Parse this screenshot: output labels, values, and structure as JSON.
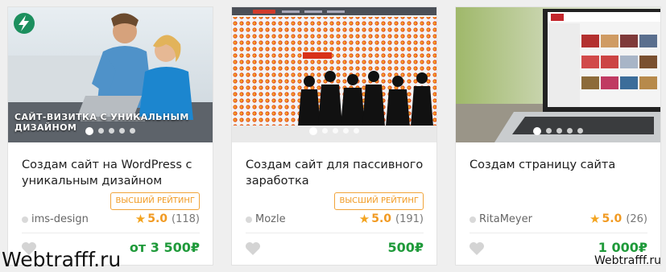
{
  "cards": [
    {
      "thumb_banner": "САЙТ-ВИЗИТКА С УНИКАЛЬНЫМ ДИЗАЙНОМ",
      "title": "Создам сайт на WordPress с уникальным дизайном",
      "badge": "ВЫСШИЙ РЕЙТИНГ",
      "seller": "ims-design",
      "rating": "5.0",
      "reviews": "(118)",
      "price": "от 3 500₽"
    },
    {
      "title": "Создам сайт для пассивного заработка",
      "badge": "ВЫСШИЙ РЕЙТИНГ",
      "seller": "Mozle",
      "rating": "5.0",
      "reviews": "(191)",
      "price": "500₽"
    },
    {
      "title": "Создам страницу сайта",
      "seller": "RitaMeyer",
      "rating": "5.0",
      "reviews": "(26)",
      "price": "1 000₽"
    }
  ],
  "icons": {
    "favorite": "heart-icon",
    "rating": "star-icon",
    "logo": "lightning-logo-icon"
  },
  "colors": {
    "price": "#1f9a3a",
    "badge": "#f19a22",
    "star": "#f3a41f"
  },
  "watermark": {
    "large": "Webtrafff.ru",
    "small": "Webtrafff.ru"
  }
}
